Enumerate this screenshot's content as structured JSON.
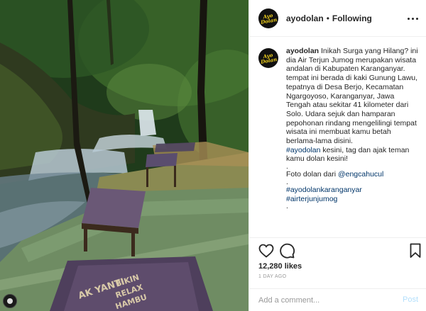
{
  "post": {
    "username": "ayodolan",
    "follow_status": "Following",
    "avatar_text": "Ayo Dolan"
  },
  "photo": {
    "board_text_1": "AK YANTI",
    "board_text_2": "BIKIN",
    "board_text_3": "RELAX",
    "board_text_4": "HAMBU"
  },
  "caption": {
    "username": "ayodolan",
    "intro": "Inikah Surga yang Hilang? ini dia Air Terjun Jumog merupakan wisata andalan di Kabupaten Karanganyar. tempat ini berada di kaki Gunung Lawu, tepatnya di Desa Berjo, Kecamatan Ngargoyoso, Karanganyar, Jawa Tengah atau sekitar 41 kilometer dari Solo. Udara sejuk dan hamparan pepohonan rindang mengelilingi tempat wisata ini membuat kamu betah berlama-lama disini.",
    "hashtag_main": "#ayodolan",
    "hashtag_main_rest": " kesini, tag dan ajak teman kamu dolan kesini!",
    "dot1": ".",
    "photo_credit_prefix": "Foto dolan dari ",
    "photo_credit_user": "@engcahucul",
    "dot2": ".",
    "hashtag_2": "#ayodolankaranganyar",
    "hashtag_3": "#airterjunjumog",
    "dot3": "."
  },
  "engagement": {
    "likes": "12,280 likes",
    "timestamp": "1 DAY AGO"
  },
  "comment": {
    "placeholder": "Add a comment...",
    "post_label": "Post"
  },
  "icons": {
    "like": "heart-icon",
    "comment": "comment-icon",
    "save": "bookmark-icon",
    "more": "more-icon"
  }
}
